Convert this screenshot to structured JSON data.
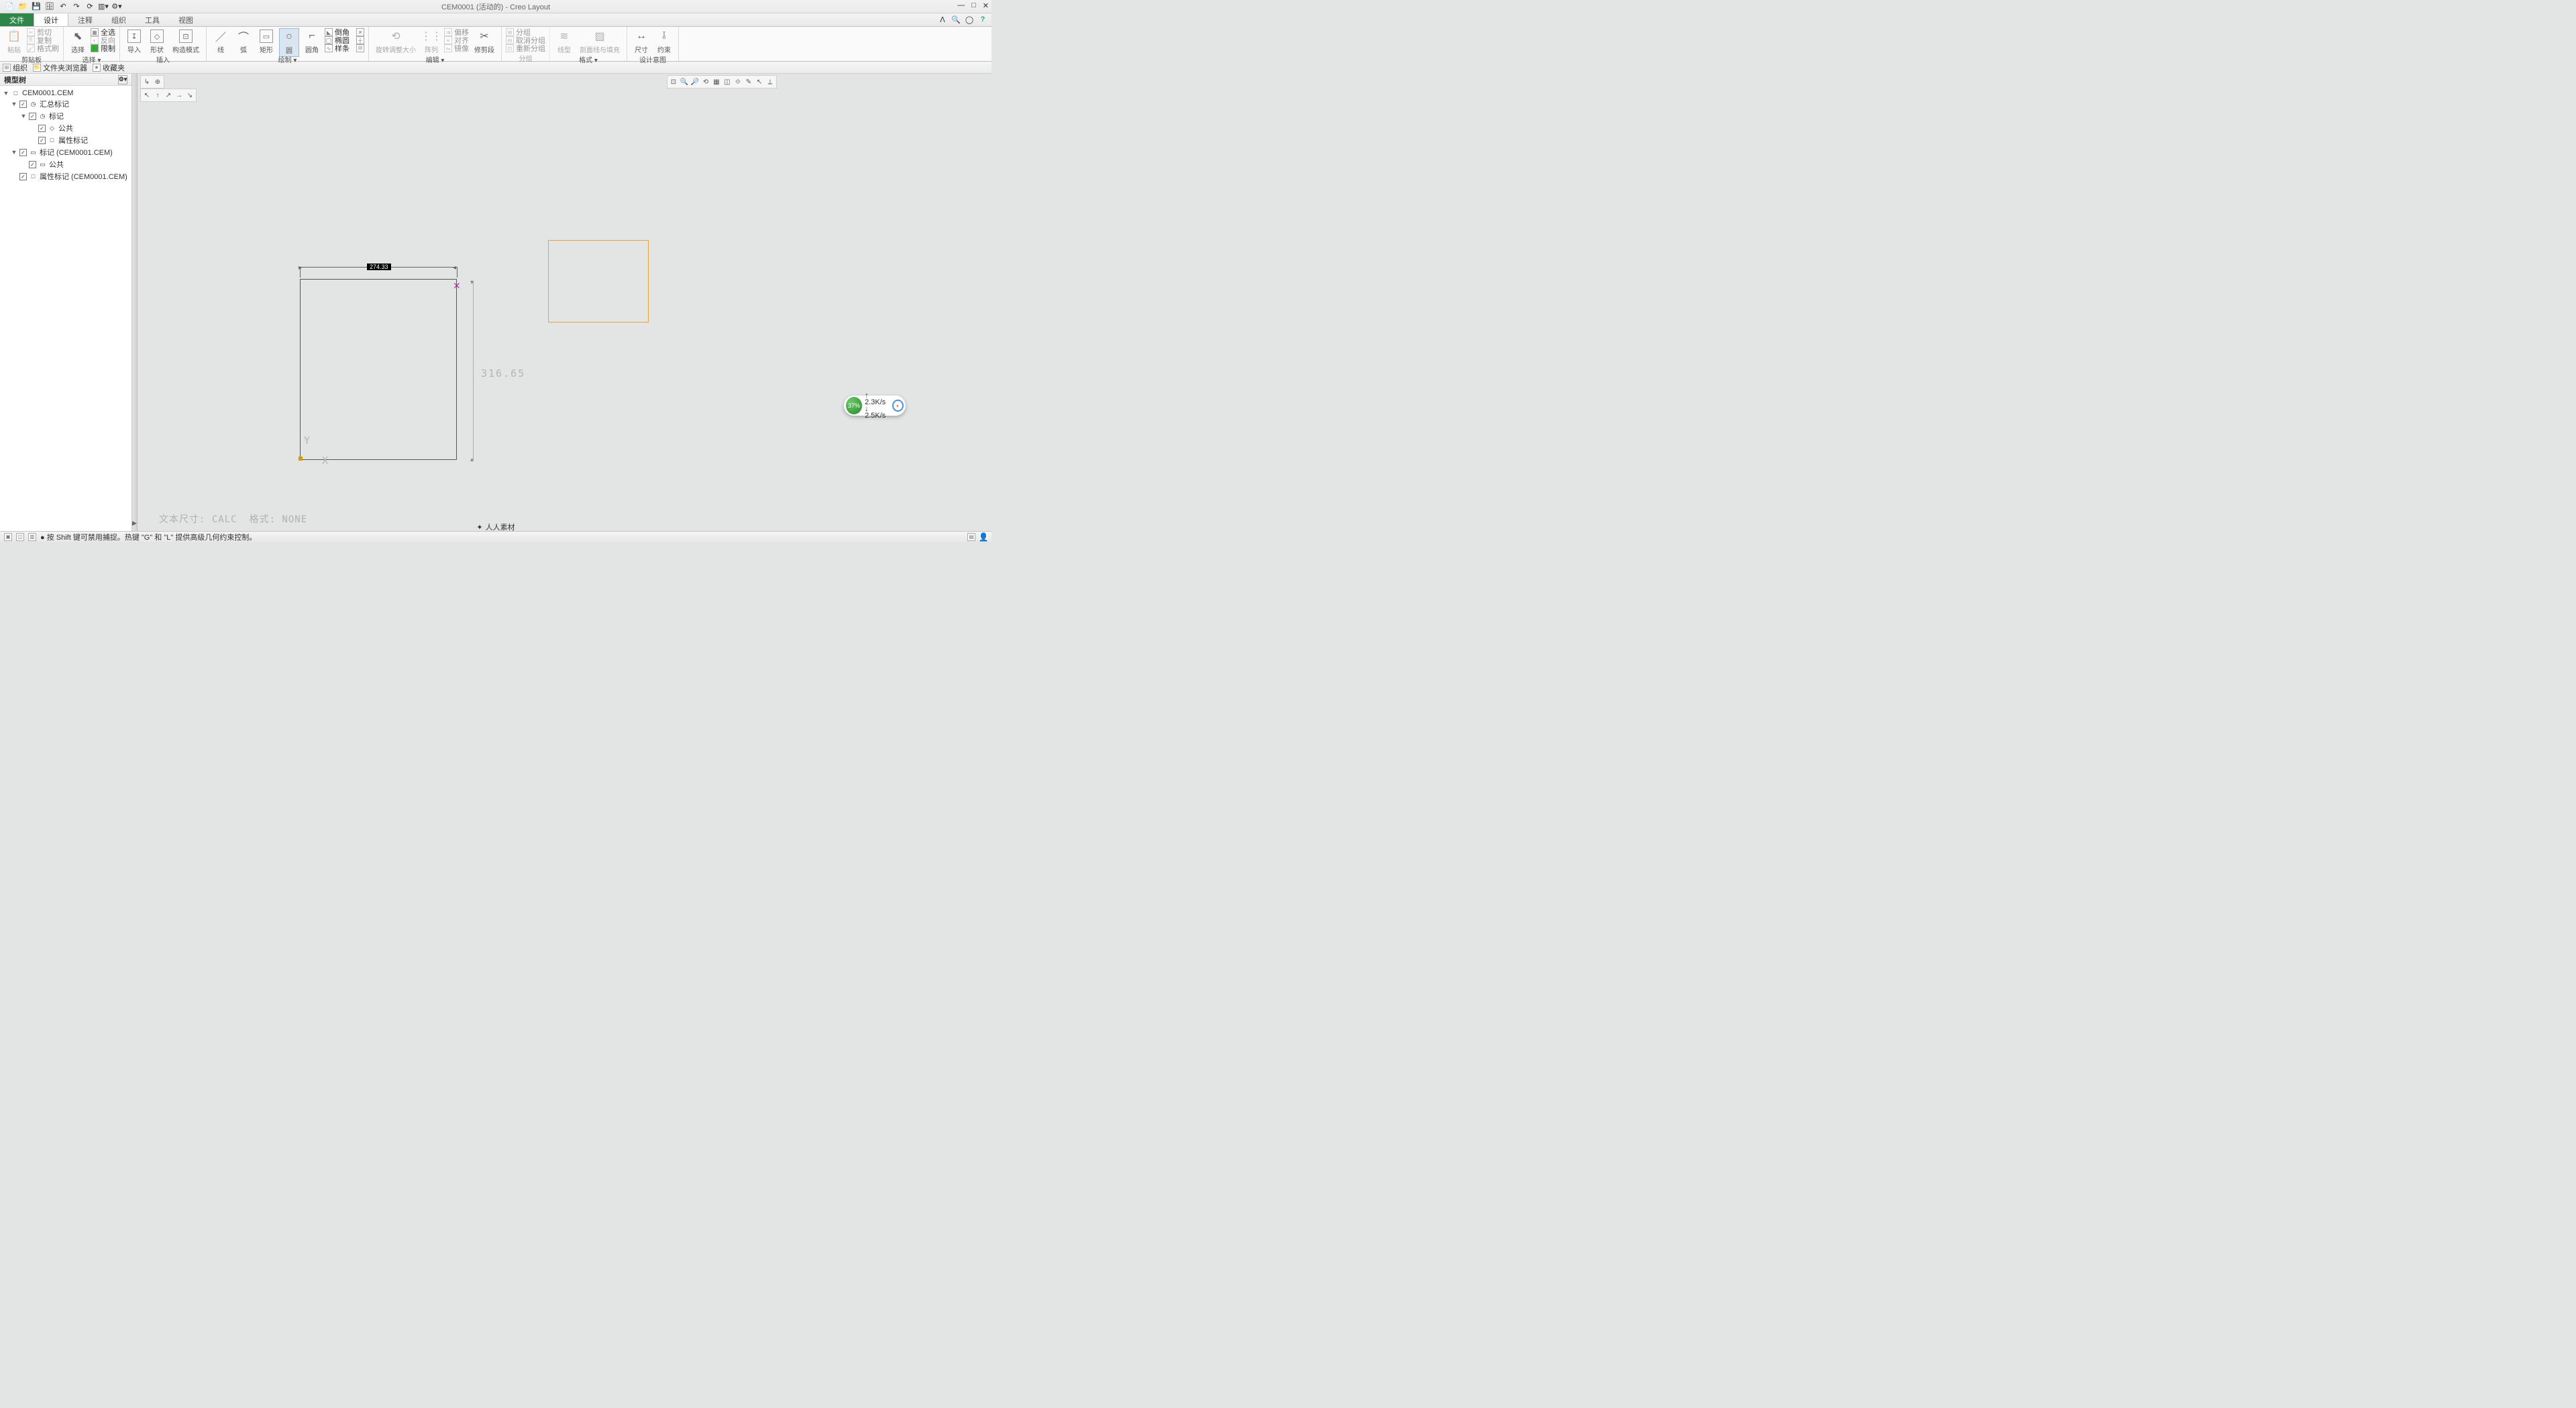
{
  "app": {
    "title": "CEM0001 (活动的) - Creo Layout",
    "qat_icons": [
      "new",
      "open",
      "save",
      "saveall",
      "undo",
      "redo",
      "regen",
      "windows",
      "config"
    ]
  },
  "tabs": {
    "file": "文件",
    "items": [
      "设计",
      "注释",
      "组织",
      "工具",
      "视图"
    ],
    "active": "设计"
  },
  "ribbon": {
    "groups": [
      {
        "name": "剪贴板",
        "big": {
          "label": "粘贴"
        },
        "small": [
          "剪切",
          "复制",
          "格式刷"
        ]
      },
      {
        "name": "选择 ▾",
        "big": {
          "label": "选择"
        },
        "small": [
          "全选",
          "反向",
          "限制"
        ]
      },
      {
        "name": "插入",
        "items": [
          {
            "label": "导入"
          },
          {
            "label": "形状"
          },
          {
            "label": "构造模式"
          }
        ]
      },
      {
        "name": "绘制 ▾",
        "items": [
          {
            "label": "线"
          },
          {
            "label": "弧"
          },
          {
            "label": "矩形"
          },
          {
            "label": "圆"
          },
          {
            "label": "圆角"
          }
        ],
        "small": [
          "倒角",
          "椭圆",
          "样条"
        ]
      },
      {
        "name": "编辑 ▾",
        "items": [
          {
            "label": "旋转调整大小"
          },
          {
            "label": "阵列"
          }
        ],
        "small": [
          "偏移",
          "对齐",
          "镜像"
        ],
        "trim": {
          "label": "修剪段"
        }
      },
      {
        "name": "分组",
        "small": [
          "分组",
          "取消分组",
          "重新分组"
        ]
      },
      {
        "name": "格式 ▾",
        "items": [
          {
            "label": "线型"
          },
          {
            "label": "剖面线与填充"
          }
        ]
      },
      {
        "name": "设计意图",
        "items": [
          {
            "label": "尺寸"
          },
          {
            "label": "约束"
          }
        ]
      }
    ]
  },
  "navbar": {
    "items": [
      "组织",
      "文件夹浏览器",
      "收藏夹"
    ]
  },
  "sidebar": {
    "title": "模型树",
    "nodes": [
      {
        "level": 0,
        "toggle": "▼",
        "check": false,
        "icon": "□",
        "label": "CEM0001.CEM"
      },
      {
        "level": 1,
        "toggle": "▼",
        "check": true,
        "icon": "◷",
        "label": "汇总标记"
      },
      {
        "level": 2,
        "toggle": "▼",
        "check": true,
        "icon": "◷",
        "label": "标记"
      },
      {
        "level": 3,
        "toggle": "",
        "check": true,
        "icon": "◇",
        "label": "公共"
      },
      {
        "level": 3,
        "toggle": "",
        "check": true,
        "icon": "□",
        "label": "属性标记"
      },
      {
        "level": 1,
        "toggle": "▼",
        "check": true,
        "icon": "▭",
        "label": "标记 (CEM0001.CEM)"
      },
      {
        "level": 2,
        "toggle": "",
        "check": true,
        "icon": "▭",
        "label": "公共"
      },
      {
        "level": 1,
        "toggle": "",
        "check": true,
        "icon": "□",
        "label": "属性标记 (CEM0001.CEM)"
      }
    ]
  },
  "canvas": {
    "dim_horizontal": "274.33",
    "dim_vertical": "316.65",
    "axis_x": "X",
    "axis_y": "Y",
    "footer_text_size": "文本尺寸: CALC",
    "footer_format": "格式: NONE"
  },
  "float": {
    "pct": "37%",
    "up": "2.3K/s",
    "down": "2.5K/s"
  },
  "status": {
    "tip": "● 按 Shift 键可禁用捕捉。热键 \"G\" 和 \"L\" 提供高级几何约束控制。",
    "watermark": "人人素材"
  }
}
